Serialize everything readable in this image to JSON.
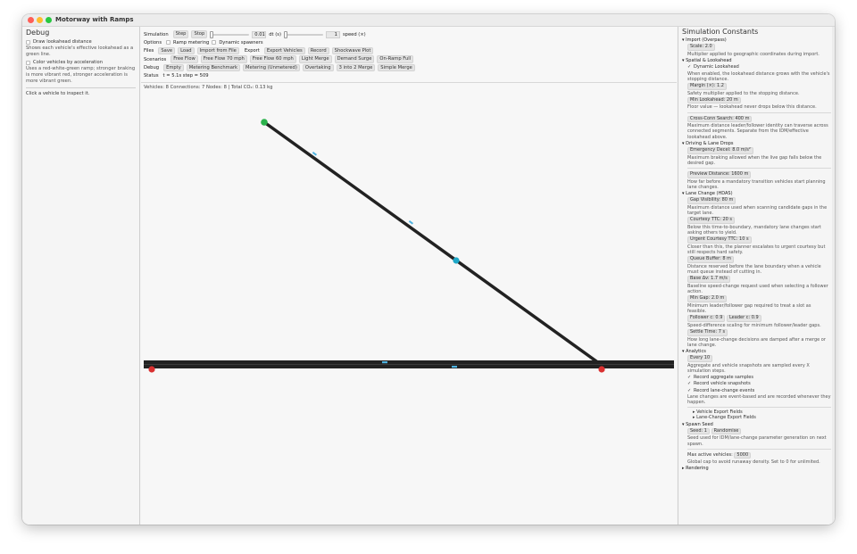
{
  "window": {
    "title": "Motorway with Ramps"
  },
  "debug_panel": {
    "title": "Debug",
    "draw_lookahead": "Draw lookahead distance",
    "draw_lookahead_hint": "Shows each vehicle's effective lookahead as a green line.",
    "color_accel": "Color vehicles by acceleration",
    "color_accel_hint": "Uses a red-white-green ramp; stronger braking is more vibrant red, stronger acceleration is more vibrant green.",
    "inspect_hint": "Click a vehicle to inspect it."
  },
  "toolbar": {
    "simulation_label": "Simulation",
    "step": "Step",
    "stop": "Stop",
    "dt_value": "0.01",
    "dt_label": "dt (s)",
    "speed_value": "1",
    "speed_label": "speed (×)",
    "options_label": "Options",
    "ramp_metering": "Ramp metering",
    "dynamic_spawners": "Dynamic spawners",
    "files_label": "Files",
    "files": [
      "Save",
      "Load",
      "Import from File"
    ],
    "export_label": "Export",
    "exports": [
      "Export Vehicles",
      "Record",
      "Shockwave Plot"
    ],
    "scenarios_label": "Scenarios",
    "scenarios": [
      "Free Flow",
      "Free Flow 70 mph",
      "Free Flow 60 mph",
      "Light Merge",
      "Demand Surge",
      "On-Ramp Full"
    ],
    "debug_label": "Debug",
    "debug_items": [
      "Empty",
      "Metering Benchmark",
      "Metering (Unmetered)",
      "Overtaking",
      "3 into 2 Merge",
      "Simple Merge"
    ],
    "status_label": "Status",
    "status_text": "t = 5.1s   step = 509"
  },
  "stats": {
    "text": "Vehicles: 8   Connections: 7   Nodes: 8  |  Total CO₂: 0.13 kg"
  },
  "colors": {
    "road": "#222222",
    "node_green": "#2bb24c",
    "node_red": "#d93030",
    "node_cyan": "#1ea8c8",
    "vehicle": "#4fb3e0"
  },
  "constants_panel": {
    "title": "Simulation Constants",
    "import": {
      "header": "▾ Import (Overpass)",
      "scale": "Scale: 2.0",
      "scale_desc": "Multiplier applied to geographic coordinates during import."
    },
    "spatial": {
      "header": "▾ Spatial & Lookahead",
      "dynamic": "Dynamic Lookahead",
      "dynamic_desc": "When enabled, the lookahead distance grows with the vehicle's stopping distance.",
      "margin": "Margin (×): 1.2",
      "margin_desc": "Safety multiplier applied to the stopping distance.",
      "min_lookahead": "Min Lookahead: 20 m",
      "min_desc": "Floor value — lookahead never drops below this distance.",
      "cross_conn": "Cross-Conn Search: 400 m",
      "cross_desc": "Maximum distance leader/follower identity can traverse across connected segments. Separate from the IDM/effective lookahead above."
    },
    "driving": {
      "header": "▾ Driving & Lane Drops",
      "emergency": "Emergency Decel: 8.0 m/s²",
      "emergency_desc": "Maximum braking allowed when the live gap falls below the desired gap.",
      "preview": "Preview Distance: 1600 m",
      "preview_desc": "How far before a mandatory transition vehicles start planning lane changes."
    },
    "lane_change": {
      "header": "▾ Lane Change (HDAS)",
      "gap_vis": "Gap Visibility: 80 m",
      "gap_desc": "Maximum distance used when scanning candidate gaps in the target lane.",
      "courtesy": "Courtesy TTC: 20 s",
      "courtesy_desc": "Below this time-to-boundary, mandatory lane changes start asking others to yield.",
      "urgent": "Urgent Courtesy TTC: 10 s",
      "urgent_desc": "Closer than this, the planner escalates to urgent courtesy but still respects hard safety.",
      "queue": "Queue Buffer: 8 m",
      "queue_desc": "Distance reserved before the lane boundary when a vehicle must queue instead of cutting in.",
      "base": "Base Δv: 1.7 m/s",
      "base_desc": "Baseline speed-change request used when selecting a follower action.",
      "min_gap": "Min Gap: 2.0 m",
      "min_gap_desc": "Minimum leader/follower gap required to treat a slot as feasible.",
      "follower": "Follower c: 0.9",
      "leader": "Leader c: 0.9",
      "fl_desc": "Speed-difference scaling for minimum follower/leader gaps.",
      "settle": "Settle Time: 7 s",
      "settle_desc": "How long lane-change decisions are damped after a merge or lane change."
    },
    "analytics": {
      "header": "▾ Analytics",
      "every": "Every 10",
      "every_desc": "Aggregate and vehicle snapshots are sampled every X simulation steps.",
      "rec_agg": "Record aggregate samples",
      "rec_veh": "Record vehicle snapshots",
      "rec_lane": "Record lane-change events",
      "rec_desc": "Lane changes are event-based and are recorded whenever they happen.",
      "veh_fields": "▸ Vehicle Export Fields",
      "lane_fields": "▸ Lane-Change Export Fields"
    },
    "spawner": {
      "header": "▾ Spawn Seed",
      "seed": "Seed: 1",
      "randomise": "Randomise",
      "seed_desc": "Seed used for IDM/lane-change parameter generation on next spawn.",
      "max_label": "Max active vehicles:",
      "max_value": "5000",
      "max_desc": "Global cap to avoid runaway density. Set to 0 for unlimited.",
      "rendering": "▸ Rendering"
    }
  }
}
